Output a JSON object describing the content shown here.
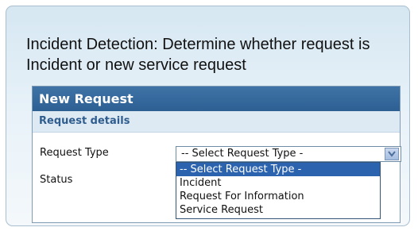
{
  "caption": {
    "line1": "Incident Detection: Determine whether request is",
    "line2": "Incident or new service request"
  },
  "panel": {
    "title": "New Request",
    "section_title": "Request details"
  },
  "form": {
    "request_type_label": "Request Type",
    "status_label": "Status",
    "request_type_value": "-- Select Request Type -",
    "dropdown_icon": "chevron-down-icon"
  },
  "dropdown": {
    "options": [
      "-- Select Request Type -",
      "Incident",
      "Request For Information",
      "Service Request"
    ],
    "highlighted_index": 0
  },
  "colors": {
    "header_bg": "#3f73a6",
    "section_text": "#2f5d8e",
    "highlight_bg": "#2c63ae",
    "card_bg": "#d6e7f2"
  }
}
